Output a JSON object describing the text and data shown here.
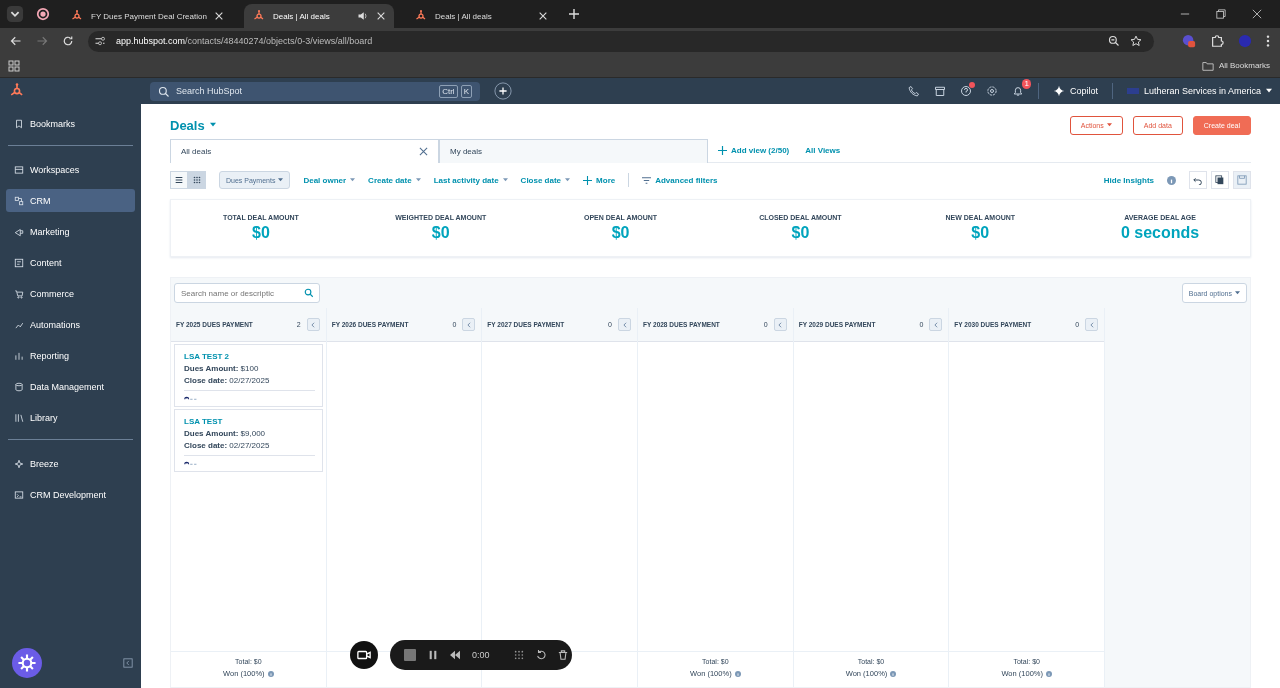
{
  "browser": {
    "tabs": [
      {
        "title": "FY Dues Payment Deal Creation",
        "selected": false,
        "audio": false
      },
      {
        "title": "Deals | All deals",
        "selected": true,
        "audio": true
      },
      {
        "title": "Deals | All deals",
        "selected": false,
        "audio": false
      }
    ],
    "url_host": "app.hubspot.com",
    "url_path": "/contacts/48440274/objects/0-3/views/all/board",
    "bookmarks_label": "All Bookmarks"
  },
  "topbar": {
    "search_placeholder": "Search HubSpot",
    "shortcut_keys": [
      "Ctrl",
      "K"
    ],
    "notification_count": "1",
    "copilot": "Copilot",
    "account": "Lutheran Services in America"
  },
  "sidebar": {
    "groups": [
      {
        "items": [
          {
            "label": "Bookmarks",
            "selected": false
          }
        ]
      },
      {
        "items": [
          {
            "label": "Workspaces",
            "selected": false
          },
          {
            "label": "CRM",
            "selected": true
          },
          {
            "label": "Marketing",
            "selected": false
          },
          {
            "label": "Content",
            "selected": false
          },
          {
            "label": "Commerce",
            "selected": false
          },
          {
            "label": "Automations",
            "selected": false
          },
          {
            "label": "Reporting",
            "selected": false
          },
          {
            "label": "Data Management",
            "selected": false
          },
          {
            "label": "Library",
            "selected": false
          }
        ]
      },
      {
        "items": [
          {
            "label": "Breeze",
            "selected": false
          },
          {
            "label": "CRM Development",
            "selected": false
          }
        ]
      }
    ]
  },
  "page": {
    "title": "Deals",
    "actions": [
      {
        "label": "Actions",
        "kind": "menu"
      },
      {
        "label": "Add data",
        "kind": "outline"
      },
      {
        "label": "Create deal",
        "kind": "primary"
      }
    ],
    "views": [
      {
        "label": "All deals",
        "selected": true
      },
      {
        "label": "My deals",
        "selected": false
      }
    ],
    "add_view": "Add view (2/50)",
    "all_views": "All Views",
    "view_mode": [
      {
        "kind": "list",
        "selected": false
      },
      {
        "kind": "board",
        "selected": true
      }
    ],
    "pipeline": "Dues Payments",
    "filters": [
      "Deal owner",
      "Create date",
      "Last activity date",
      "Close date"
    ],
    "more": "More",
    "advanced_filters": "Advanced filters",
    "hide_insights": "Hide Insights"
  },
  "insights": [
    {
      "label": "TOTAL DEAL AMOUNT",
      "value": "$0"
    },
    {
      "label": "WEIGHTED DEAL AMOUNT",
      "value": "$0"
    },
    {
      "label": "OPEN DEAL AMOUNT",
      "value": "$0"
    },
    {
      "label": "CLOSED DEAL AMOUNT",
      "value": "$0"
    },
    {
      "label": "NEW DEAL AMOUNT",
      "value": "$0"
    },
    {
      "label": "AVERAGE DEAL AGE",
      "value": "0 seconds"
    }
  ],
  "board": {
    "search_placeholder": "Search name or descriptic",
    "options": "Board options",
    "columns": [
      {
        "title": "FY 2025 DUES PAYMENT",
        "count": "2",
        "cards": [
          {
            "name": "LSA TEST 2",
            "amount_label": "Dues Amount:",
            "amount": "$100",
            "date_label": "Close date:",
            "date": "02/27/2025"
          },
          {
            "name": "LSA TEST",
            "amount_label": "Dues Amount:",
            "amount": "$9,000",
            "date_label": "Close date:",
            "date": "02/27/2025"
          }
        ],
        "total": "Total: $0",
        "won": "Won (100%)"
      },
      {
        "title": "FY 2026 DUES PAYMENT",
        "count": "0"
      },
      {
        "title": "FY 2027 DUES PAYMENT",
        "count": "0"
      },
      {
        "title": "FY 2028 DUES PAYMENT",
        "count": "0",
        "total": "Total: $0",
        "won": "Won (100%)"
      },
      {
        "title": "FY 2029 DUES PAYMENT",
        "count": "0",
        "total": "Total: $0",
        "won": "Won (100%)"
      },
      {
        "title": "FY 2030 DUES PAYMENT",
        "count": "0",
        "total": "Total: $0",
        "won": "Won (100%)"
      }
    ]
  },
  "recorder": {
    "time": "0:00"
  }
}
